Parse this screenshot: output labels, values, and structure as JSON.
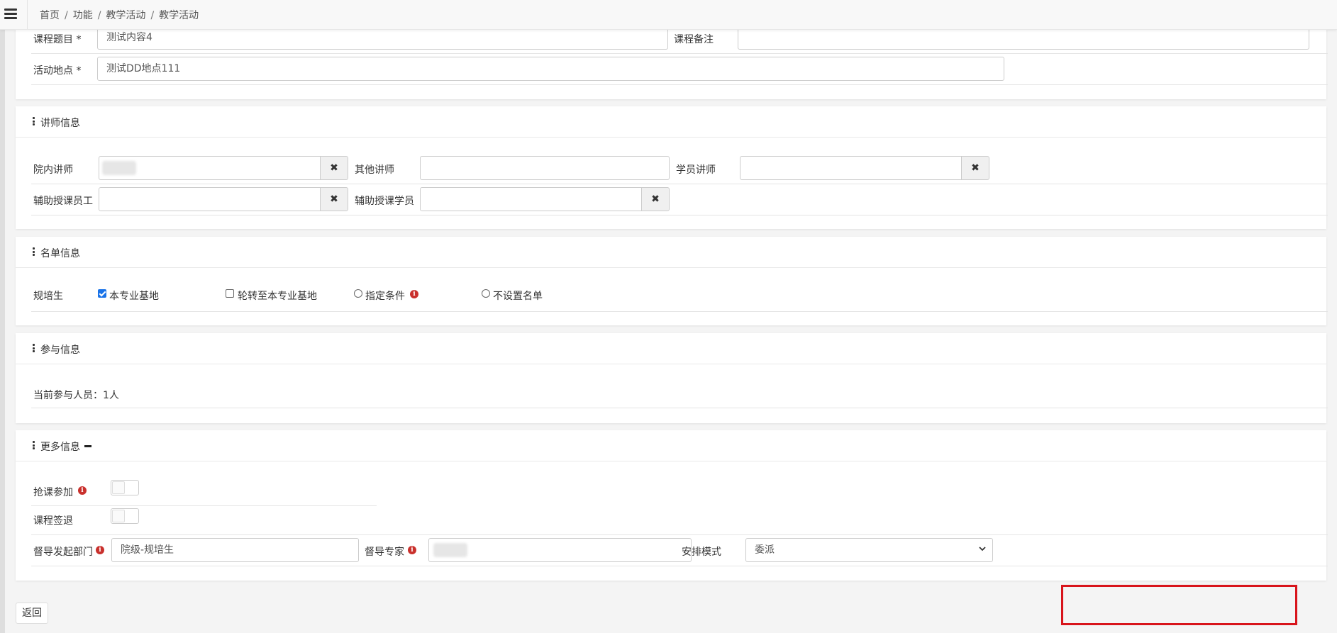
{
  "breadcrumb": [
    "首页",
    "功能",
    "教学活动",
    "教学活动"
  ],
  "course": {
    "title_label": "课程题目 *",
    "title_value": "测试内容4",
    "remark_label": "课程备注",
    "remark_value": "",
    "location_label": "活动地点 *",
    "location_value": "测试DD地点111"
  },
  "lecturer": {
    "heading": "讲师信息",
    "internal_label": "院内讲师",
    "other_label": "其他讲师",
    "student_label": "学员讲师",
    "assist_staff_label": "辅助授课员工",
    "assist_student_label": "辅助授课学员",
    "clear_glyph": "✖"
  },
  "roster": {
    "heading": "名单信息",
    "group_label": "规培生",
    "options": [
      {
        "label": "本专业基地",
        "type": "checkbox",
        "checked": true
      },
      {
        "label": "轮转至本专业基地",
        "type": "checkbox",
        "checked": false
      },
      {
        "label": "指定条件",
        "type": "radio",
        "checked": false
      },
      {
        "label": "不设置名单",
        "type": "radio",
        "checked": false
      }
    ]
  },
  "participation": {
    "heading": "参与信息",
    "current_text": "当前参与人员：1人"
  },
  "more": {
    "heading": "更多信息",
    "grab_label": "抢课参加",
    "signout_label": "课程签退",
    "dept_label": "督导发起部门",
    "dept_value": "院级-规培生",
    "expert_label": "督导专家",
    "mode_label": "安排模式",
    "mode_value": "委派"
  },
  "actions": {
    "back_label": "返回"
  },
  "colors": {
    "checkbox_checked": "#1a73e8",
    "info_icon": "#c9302c",
    "highlight_box": "#d8141b"
  }
}
